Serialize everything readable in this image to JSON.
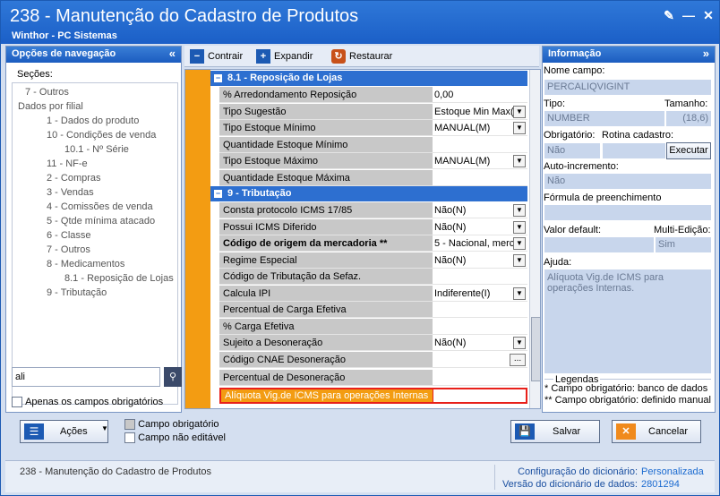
{
  "window": {
    "title": "238 - Manutenção do Cadastro de Produtos",
    "subtitle": "Winthor - PC Sistemas"
  },
  "nav": {
    "title": "Opções de navegação",
    "sections_label": "Seções:",
    "items": [
      {
        "label": "7 - Outros",
        "indent": 1
      },
      {
        "label": "Dados por filial",
        "indent": 0
      },
      {
        "label": "1 - Dados do produto",
        "indent": 2
      },
      {
        "label": "10 - Condições de venda",
        "indent": 2
      },
      {
        "label": "10.1 - Nº Série",
        "indent": 3
      },
      {
        "label": "11 - NF-e",
        "indent": 2
      },
      {
        "label": "2 - Compras",
        "indent": 2
      },
      {
        "label": "3 - Vendas",
        "indent": 2
      },
      {
        "label": "4 - Comissões de venda",
        "indent": 2
      },
      {
        "label": "5 - Qtde mínima atacado",
        "indent": 2
      },
      {
        "label": "6 - Classe",
        "indent": 2
      },
      {
        "label": "7 - Outros",
        "indent": 2
      },
      {
        "label": "8 - Medicamentos",
        "indent": 2
      },
      {
        "label": "8.1 - Reposição de Lojas",
        "indent": 3
      },
      {
        "label": "9 - Tributação",
        "indent": 2
      }
    ],
    "search_value": "ali",
    "only_required_label": "Apenas os campos obrigatórios"
  },
  "toolbar": {
    "contrair": "Contrair",
    "expandir": "Expandir",
    "restaurar": "Restaurar"
  },
  "grid": {
    "groups": [
      {
        "title": "8.1 -  Reposição de Lojas",
        "rows": [
          {
            "name": "% Arredondamento Reposição",
            "value": "0,00",
            "dropdown": false,
            "bold": false
          },
          {
            "name": "Tipo Sugestão",
            "value": "Estoque Min Max(",
            "dropdown": true,
            "bold": false
          },
          {
            "name": "Tipo Estoque Mínimo",
            "value": "MANUAL(M)",
            "dropdown": true,
            "bold": false
          },
          {
            "name": "Quantidade Estoque Mínimo",
            "value": "",
            "dropdown": false,
            "bold": false
          },
          {
            "name": "Tipo Estoque Máximo",
            "value": "MANUAL(M)",
            "dropdown": true,
            "bold": false
          },
          {
            "name": "Quantidade Estoque Máxima",
            "value": "",
            "dropdown": false,
            "bold": false
          }
        ]
      },
      {
        "title": "9 - Tributação",
        "rows": [
          {
            "name": "Consta protocolo ICMS 17/85",
            "value": "Não(N)",
            "dropdown": true,
            "bold": false
          },
          {
            "name": "Possui ICMS Diferido",
            "value": "Não(N)",
            "dropdown": true,
            "bold": false
          },
          {
            "name": "Código de origem da mercadoria **",
            "value": "5 - Nacional, merc",
            "dropdown": true,
            "bold": true
          },
          {
            "name": "Regime Especial",
            "value": "Não(N)",
            "dropdown": true,
            "bold": false
          },
          {
            "name": "Código de Tributação da Sefaz.",
            "value": "",
            "dropdown": false,
            "bold": false
          },
          {
            "name": "Calcula IPI",
            "value": "Indiferente(I)",
            "dropdown": true,
            "bold": false
          },
          {
            "name": "Percentual de Carga Efetiva",
            "value": "",
            "dropdown": false,
            "bold": false
          },
          {
            "name": "%  Carga Efetiva",
            "value": "",
            "dropdown": false,
            "bold": false
          },
          {
            "name": "Sujeito a Desoneração",
            "value": "Não(N)",
            "dropdown": true,
            "bold": false
          },
          {
            "name": "Código CNAE Desoneração",
            "value": "",
            "dropdown": false,
            "bold": false,
            "ellipsis": "..."
          },
          {
            "name": "Percentual de Desoneração",
            "value": "",
            "dropdown": false,
            "bold": false
          },
          {
            "name": "Alíquota Vig.de ICMS para operações Internas",
            "value": "",
            "dropdown": false,
            "bold": false,
            "selected": true
          }
        ]
      }
    ]
  },
  "info": {
    "title": "Informação",
    "nome_campo_label": "Nome campo:",
    "nome_campo": "PERCALIQVIGINT",
    "tipo_label": "Tipo:",
    "tipo": "NUMBER",
    "tamanho_label": "Tamanho:",
    "tamanho": "(18,6)",
    "obrigatorio_label": "Obrigatório:",
    "obrigatorio": "Não",
    "rotina_label": "Rotina cadastro:",
    "executar": "Executar",
    "autoinc_label": "Auto-incremento:",
    "autoinc": "Não",
    "formula_label": "Fórmula de preenchimento",
    "default_label": "Valor default:",
    "multiedicao_label": "Multi-Edição:",
    "multiedicao": "Sim",
    "ajuda_label": "Ajuda:",
    "ajuda": "Alíquota Vig.de ICMS para operações Internas.",
    "legendas_label": "Legendas",
    "legenda1": "* Campo obrigatório: banco de dados",
    "legenda2": "** Campo obrigatório: definido manual"
  },
  "bottom": {
    "acoes": "Ações",
    "campo_obrigatorio": "Campo obrigatório",
    "campo_nao_editavel": "Campo não editável",
    "salvar": "Salvar",
    "cancelar": "Cancelar"
  },
  "status": {
    "routine": "238 - Manutenção do Cadastro de Produtos",
    "config_label": "Configuração do dicionário:",
    "config_value": "Personalizada",
    "version_label": "Versão do dicionário de dados:",
    "version_value": "2801294"
  },
  "colors": {
    "title_blue": "#1b5fc7",
    "group_blue": "#2d6fd0",
    "orange": "#f39c12",
    "selected_border": "#e8201a",
    "link_blue": "#1a4fa0"
  }
}
